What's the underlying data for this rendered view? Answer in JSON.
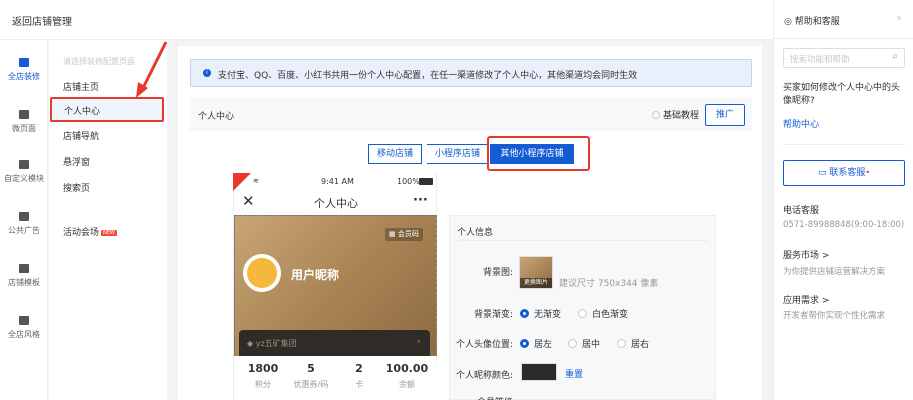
{
  "topbar": {
    "back_label": "返回店铺管理"
  },
  "left_nav": [
    {
      "label": "全店装修",
      "icon": "brush-icon",
      "active": true
    },
    {
      "label": "微页面",
      "icon": "page-icon"
    },
    {
      "label": "自定义模块",
      "icon": "module-icon"
    },
    {
      "label": "公共广告",
      "icon": "ad-icon"
    },
    {
      "label": "店铺模板",
      "icon": "template-icon"
    },
    {
      "label": "全店风格",
      "icon": "shirt-icon"
    }
  ],
  "sub_nav": {
    "hint": "请选择装修配置页面",
    "items": [
      "店铺主页",
      "个人中心",
      "店铺导航",
      "悬浮窗",
      "搜索页",
      "活动会场"
    ],
    "new_badge": "NEW"
  },
  "notice": {
    "text": "支付宝、QQ、百度、小红书共用一份个人中心配置，在任一渠道修改了个人中心，其他渠道均会同时生效"
  },
  "section": {
    "title": "个人中心",
    "tutorial": "基础教程",
    "promote": "推广"
  },
  "tabs": [
    "移动店铺",
    "小程序店铺",
    "其他小程序店铺"
  ],
  "phone": {
    "time": "9:41 AM",
    "battery": "100%",
    "title": "个人中心",
    "member_code": "会员码",
    "nickname": "用户昵称",
    "card_name": "yz五矿集团",
    "stats": [
      {
        "value": "1800",
        "label": "积分"
      },
      {
        "value": "5",
        "label": "优惠券/码"
      },
      {
        "value": "2",
        "label": "卡"
      },
      {
        "value": "100.00",
        "label": "余额"
      }
    ]
  },
  "panel": {
    "title": "个人信息",
    "bg_label": "背景图:",
    "bg_change": "更换图片",
    "bg_hint": "建议尺寸 750x344 像素",
    "gradient_label": "背景渐变:",
    "gradient_options": [
      "无渐变",
      "白色渐变"
    ],
    "avatar_label": "个人头像位置:",
    "avatar_options": [
      "居左",
      "居中",
      "居右"
    ],
    "nick_color_label": "个人昵称颜色:",
    "reset": "重置",
    "partial_label": "会员等级"
  },
  "right_panel": {
    "title": "帮助和客服",
    "search_placeholder": "搜索功能和帮助",
    "question": "买家如何修改个人中心中的头像昵称?",
    "help_center": "帮助中心",
    "contact": "联系客服",
    "phone_label": "电话客服",
    "phone_value": "0571-89988848(9:00-18:00)",
    "market_label": "服务市场 >",
    "market_desc": "为你提供店铺运营解决方案",
    "app_label": "应用需求 >",
    "app_desc": "开发者帮你实现个性化需求"
  },
  "colors": {
    "accent": "#155bd4",
    "highlight": "#e53a2e"
  }
}
